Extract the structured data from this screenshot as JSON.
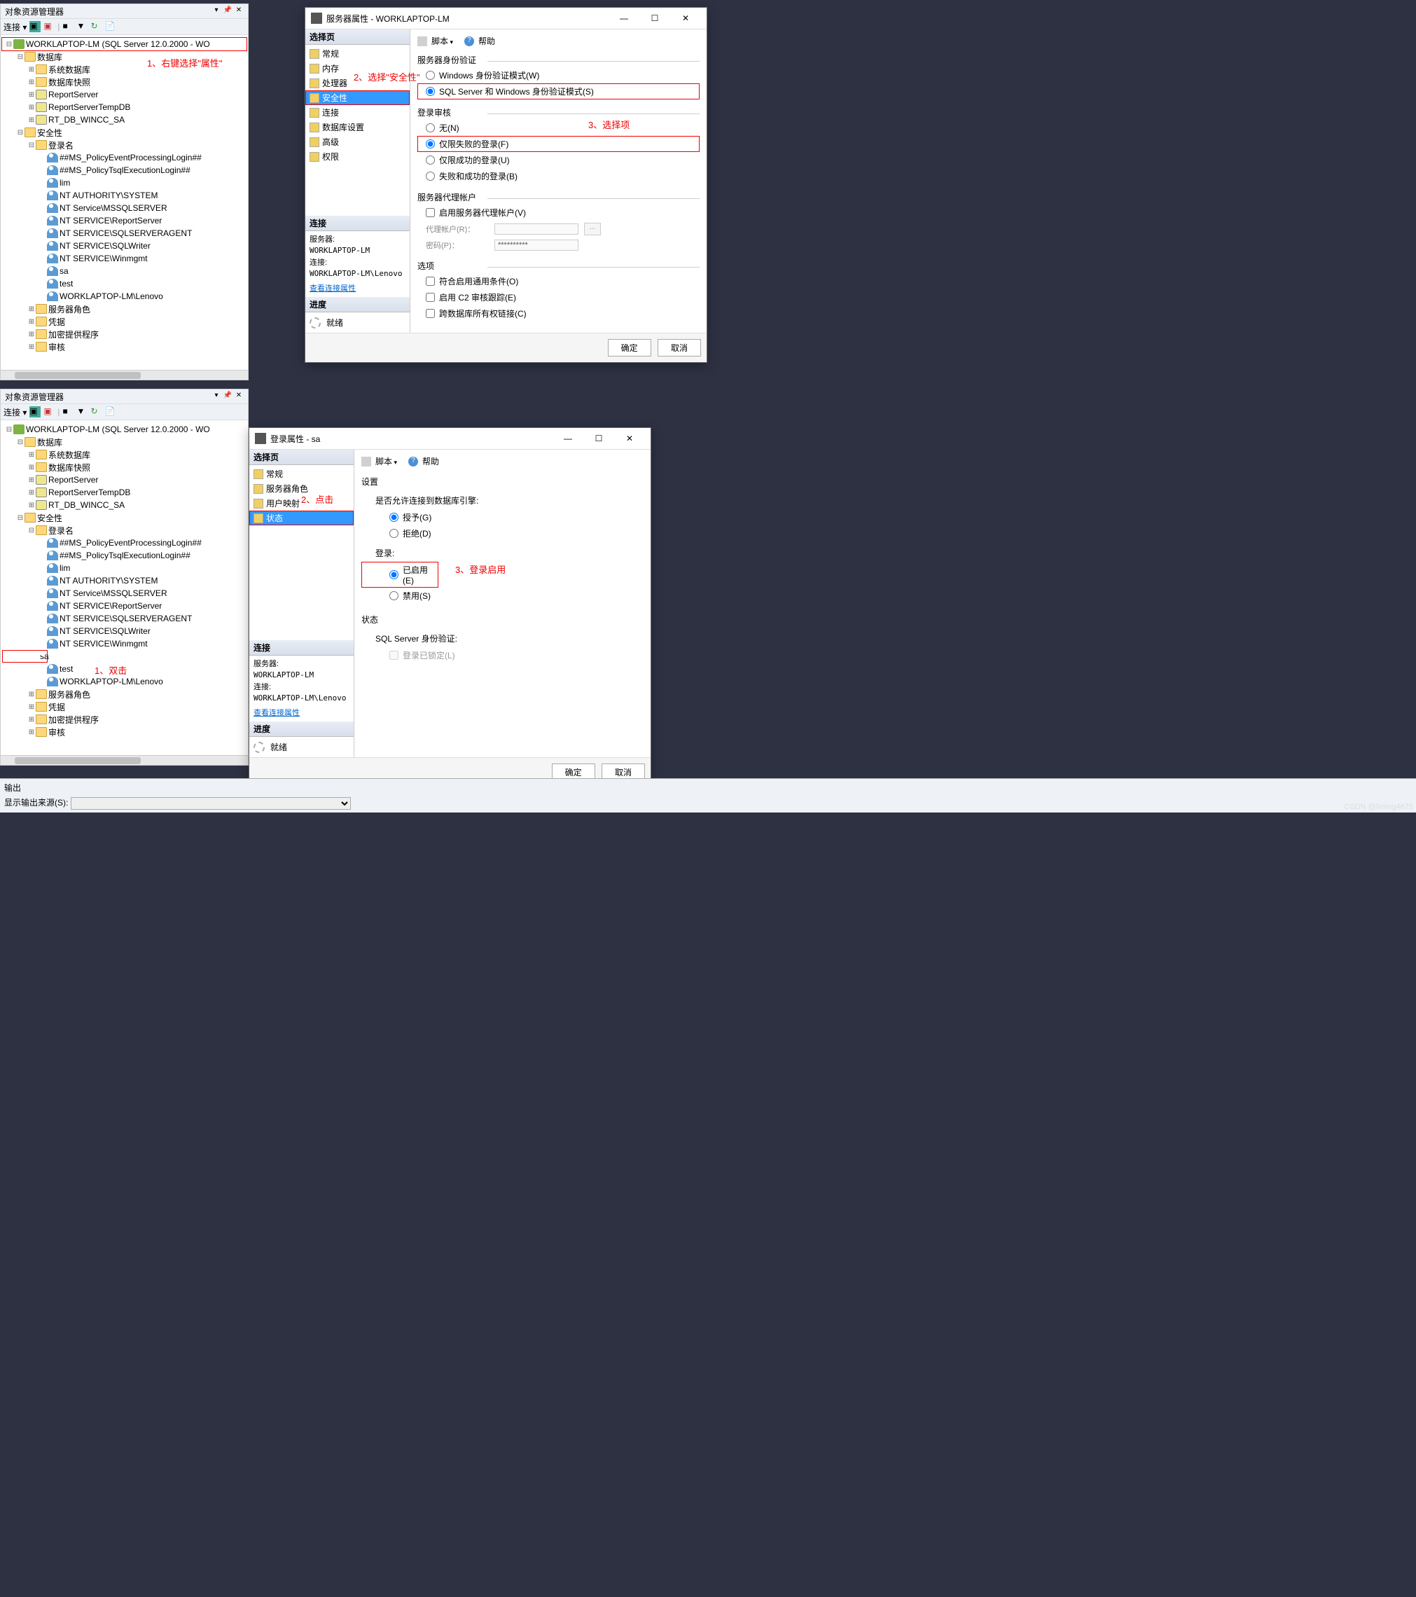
{
  "objectExplorer": {
    "title": "对象资源管理器",
    "connectLabel": "连接 ▾",
    "rootNode": "WORKLAPTOP-LM (SQL Server 12.0.2000 - WO",
    "nodes": {
      "databases": "数据库",
      "systemDatabases": "系统数据库",
      "databaseSnapshots": "数据库快照",
      "reportServer": "ReportServer",
      "reportServerTempDB": "ReportServerTempDB",
      "rtDbWincc": "RT_DB_WINCC_SA",
      "security": "安全性",
      "logins": "登录名",
      "login1": "##MS_PolicyEventProcessingLogin##",
      "login2": "##MS_PolicyTsqlExecutionLogin##",
      "login3": "lim",
      "login4": "NT AUTHORITY\\SYSTEM",
      "login5": "NT Service\\MSSQLSERVER",
      "login6": "NT SERVICE\\ReportServer",
      "login7": "NT SERVICE\\SQLSERVERAGENT",
      "login8": "NT SERVICE\\SQLWriter",
      "login9": "NT SERVICE\\Winmgmt",
      "loginSa": "sa",
      "loginTest": "test",
      "loginLenovo": "WORKLAPTOP-LM\\Lenovo",
      "serverRoles": "服务器角色",
      "credentials": "凭据",
      "cryptoProviders": "加密提供程序",
      "audits": "审核"
    }
  },
  "serverPropsDialog": {
    "title": "服务器属性 - WORKLAPTOP-LM",
    "selectPage": "选择页",
    "pages": {
      "general": "常规",
      "memory": "内存",
      "processors": "处理器",
      "security": "安全性",
      "connections": "连接",
      "dbSettings": "数据库设置",
      "advanced": "高级",
      "permissions": "权限"
    },
    "scriptLabel": "脚本",
    "helpLabel": "帮助",
    "serverAuth": {
      "legend": "服务器身份验证",
      "winMode": "Windows 身份验证模式(W)",
      "sqlMode": "SQL Server 和 Windows 身份验证模式(S)"
    },
    "loginAudit": {
      "legend": "登录审核",
      "none": "无(N)",
      "failedOnly": "仅限失败的登录(F)",
      "successOnly": "仅限成功的登录(U)",
      "both": "失败和成功的登录(B)"
    },
    "proxyAccount": {
      "legend": "服务器代理帐户",
      "enable": "启用服务器代理帐户(V)",
      "accountLabel": "代理帐户(R)：",
      "passwordLabel": "密码(P)：",
      "passwordMask": "**********"
    },
    "options": {
      "legend": "选项",
      "commonCriteria": "符合启用通用条件(O)",
      "c2Audit": "启用 C2 审核跟踪(E)",
      "crossDb": "跨数据库所有权链接(C)"
    },
    "connection": {
      "header": "连接",
      "serverLabel": "服务器:",
      "serverValue": "WORKLAPTOP-LM",
      "connLabel": "连接:",
      "connValue": "WORKLAPTOP-LM\\Lenovo",
      "viewProps": "查看连接属性"
    },
    "progress": {
      "header": "进度",
      "ready": "就绪"
    },
    "buttons": {
      "ok": "确定",
      "cancel": "取消"
    }
  },
  "loginPropsDialog": {
    "title": "登录属性 - sa",
    "selectPage": "选择页",
    "pages": {
      "general": "常规",
      "serverRoles": "服务器角色",
      "userMapping": "用户映射",
      "status": "状态"
    },
    "settings": {
      "legend": "设置",
      "connectPermLabel": "是否允许连接到数据库引擎:",
      "grant": "授予(G)",
      "deny": "拒绝(D)",
      "loginLabel": "登录:",
      "enabled": "已启用(E)",
      "disabled": "禁用(S)"
    },
    "status": {
      "legend": "状态",
      "sqlAuthLabel": "SQL Server 身份验证:",
      "lockedOut": "登录已锁定(L)"
    },
    "buttons": {
      "ok": "确定",
      "cancel": "取消"
    }
  },
  "annotations": {
    "a1": "1、右键选择\"属性\"",
    "a2": "2、选择\"安全性\"",
    "a3": "3、选择项",
    "b1": "1、双击",
    "b2": "2、点击",
    "b3": "3、登录启用"
  },
  "outputPanel": {
    "title": "输出",
    "sourceLabel": "显示输出来源(S):"
  },
  "watermark": "CSDN @liming4675"
}
